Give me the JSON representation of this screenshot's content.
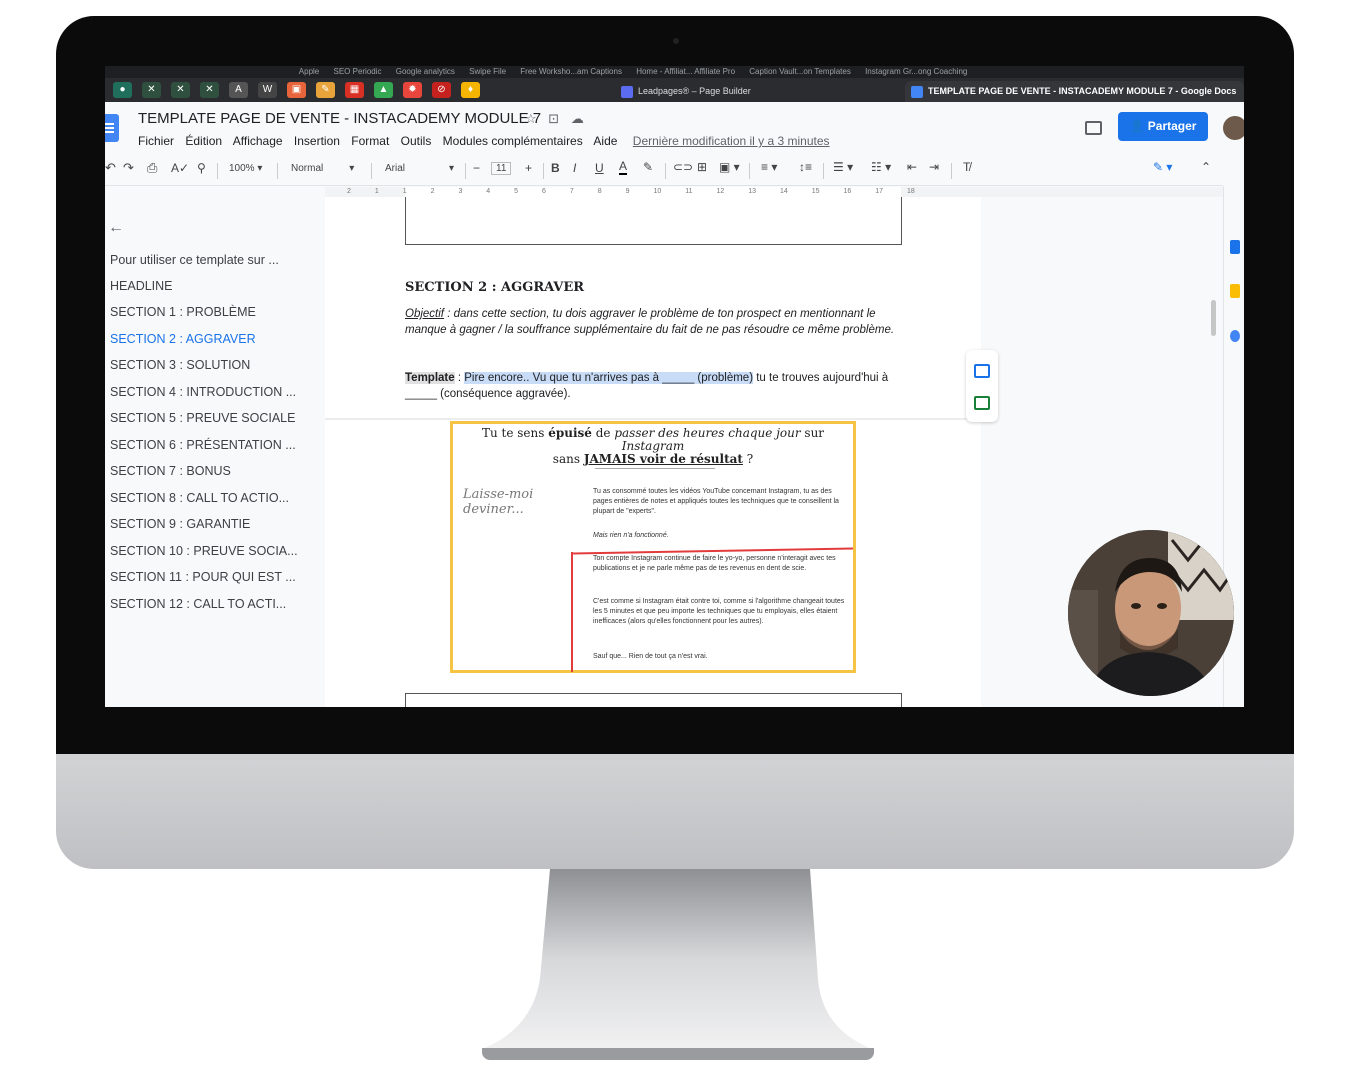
{
  "browser": {
    "bookmarks": [
      "Apple",
      "SEO Periodic",
      "Google analytics",
      "Swipe File",
      "Free Worksho...am Captions",
      "Home - Affiliat... Affiliate Pro",
      "Caption Vault...on Templates",
      "Instagram Gr...ong Coaching"
    ],
    "tabs": [
      {
        "label": "Leadpages® – Page Builder"
      },
      {
        "label": "TEMPLATE PAGE DE VENTE - INSTACADEMY MODULE 7 - Google Docs"
      }
    ]
  },
  "doc": {
    "title": "TEMPLATE PAGE DE VENTE - INSTACADEMY MODULE 7",
    "menu": [
      "Fichier",
      "Édition",
      "Affichage",
      "Insertion",
      "Format",
      "Outils",
      "Modules complémentaires",
      "Aide"
    ],
    "last_modified": "Dernière modification il y a 3 minutes",
    "share_label": "Partager"
  },
  "toolbar": {
    "zoom": "100%",
    "style": "Normal",
    "font": "Arial",
    "size": "11"
  },
  "ruler": [
    "2",
    "1",
    "1",
    "2",
    "3",
    "4",
    "5",
    "6",
    "7",
    "8",
    "9",
    "10",
    "11",
    "12",
    "13",
    "14",
    "15",
    "16",
    "17",
    "18"
  ],
  "outline": {
    "items": [
      "Pour utiliser ce template sur ...",
      "HEADLINE",
      "SECTION 1 : PROBLÈME",
      "SECTION 2 : AGGRAVER",
      "SECTION 3 : SOLUTION",
      "SECTION 4 : INTRODUCTION ...",
      "SECTION 5 : PREUVE SOCIALE",
      "SECTION 6 : PRÉSENTATION ...",
      "SECTION 7 : BONUS",
      "SECTION 8 : CALL TO ACTIO...",
      "SECTION 9 : GARANTIE",
      "SECTION 10 : PREUVE SOCIA...",
      "SECTION 11 : POUR QUI EST ...",
      "SECTION 12 : CALL TO ACTI..."
    ],
    "active_index": 3
  },
  "content": {
    "section_heading": "SECTION 2 : AGGRAVER",
    "objectif_label": "Objectif",
    "objectif_text": " : dans cette section, tu dois aggraver le problème de ton prospect en mentionnant le manque à gagner / la souffrance supplémentaire du fait de ne pas résoudre ce même problème.",
    "template_label": "Template",
    "template_sep": " : ",
    "template_selected": "Pire encore.. Vu que tu n'arrives pas à _____ (problème)",
    "template_rest": " tu te trouves aujourd'hui à _____ (conséquence aggravée)."
  },
  "image": {
    "head_line1_a": "Tu te sens ",
    "head_line1_b": "épuisé",
    "head_line1_c": " de ",
    "head_line1_d": "passer des heures chaque jour",
    "head_line1_e": " sur ",
    "head_line1_f": "Instagram",
    "head_line2_a": "sans ",
    "head_line2_b": "JAMAIS voir de résultat",
    "head_line2_c": " ?",
    "side_text": "Laisse-moi deviner...",
    "p1": "Tu as consommé toutes les vidéos YouTube concernant Instagram, tu as des pages entières de notes et appliqués toutes les techniques que te conseillent la plupart de \"experts\".",
    "p2": "Mais rien n'a fonctionné.",
    "p3": "Ton compte Instagram continue de faire le yo-yo, personne n'interagit avec tes publications et je ne parle même pas de tes revenus en dent de scie.",
    "p4": "C'est comme si Instagram était contre toi, comme si l'algorithme changeait toutes les 5 minutes et que peu importe les techniques que tu employais, elles étaient inefficaces (alors qu'elles fonctionnent pour les autres).",
    "p5": "Sauf que... Rien de tout ça n'est vrai."
  },
  "colors": {
    "accent": "#1a73e8",
    "highlight": "#c8dcf7",
    "image_border": "#f6c445",
    "red_mark": "#e23b3b"
  }
}
